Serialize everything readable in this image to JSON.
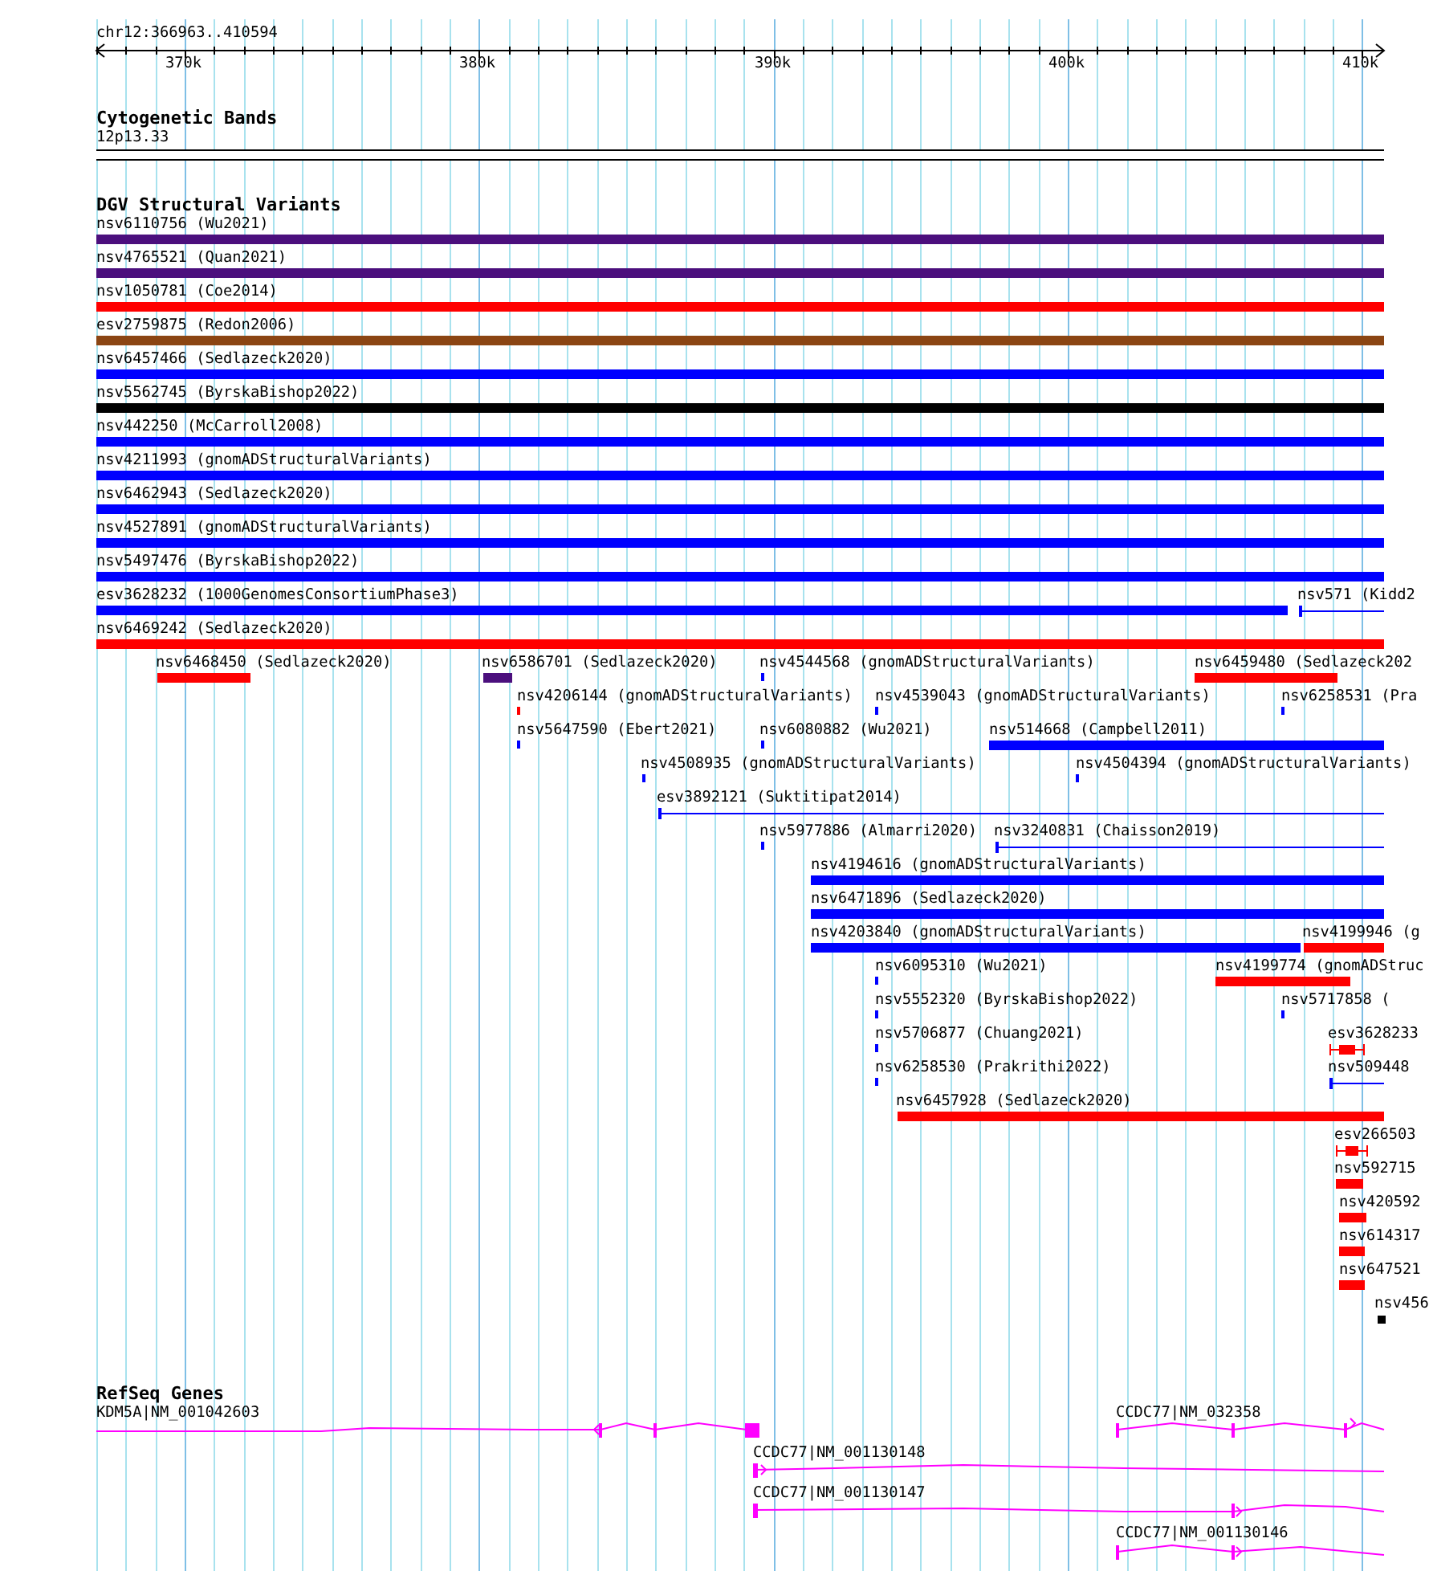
{
  "ruler": {
    "position": "chr12:366963..410594",
    "ticks": [
      "370k",
      "380k",
      "390k",
      "400k",
      "410k"
    ]
  },
  "cytogenetic_bands": {
    "title": "Cytogenetic Bands",
    "band": "12p13.33"
  },
  "dgv": {
    "title": "DGV Structural Variants",
    "rows": [
      {
        "features": [
          {
            "label": "nsv6110756 (Wu2021)",
            "kind": "bar",
            "color": "#4b0f7d"
          }
        ]
      },
      {
        "features": [
          {
            "label": "nsv4765521 (Quan2021)",
            "kind": "bar",
            "color": "#4b0f7d"
          }
        ]
      },
      {
        "features": [
          {
            "label": "nsv1050781 (Coe2014)",
            "kind": "bar",
            "color": "#ff0000"
          }
        ]
      },
      {
        "features": [
          {
            "label": "esv2759875 (Redon2006)",
            "kind": "bar",
            "color": "#8b4513"
          }
        ]
      },
      {
        "features": [
          {
            "label": "nsv6457466 (Sedlazeck2020)",
            "kind": "bar",
            "color": "#0000ff"
          }
        ]
      },
      {
        "features": [
          {
            "label": "nsv5562745 (ByrskaBishop2022)",
            "kind": "bar",
            "color": "#000000"
          }
        ]
      },
      {
        "features": [
          {
            "label": "nsv442250 (McCarroll2008)",
            "kind": "bar",
            "color": "#0000ff"
          }
        ]
      },
      {
        "features": [
          {
            "label": "nsv4211993 (gnomADStructuralVariants)",
            "kind": "bar",
            "color": "#0000ff"
          }
        ]
      },
      {
        "features": [
          {
            "label": "nsv6462943 (Sedlazeck2020)",
            "kind": "bar",
            "color": "#0000ff"
          }
        ]
      },
      {
        "features": [
          {
            "label": "nsv4527891 (gnomADStructuralVariants)",
            "kind": "bar",
            "color": "#0000ff"
          }
        ]
      },
      {
        "features": [
          {
            "label": "nsv5497476 (ByrskaBishop2022)",
            "kind": "bar",
            "color": "#0000ff"
          }
        ]
      },
      {
        "features": [
          {
            "label": "esv3628232 (1000GenomesConsortiumPhase3)",
            "kind": "bar",
            "color": "#0000ff"
          },
          {
            "label": "nsv571 (Kidd2",
            "kind": "span",
            "color": "#0000ff"
          }
        ]
      },
      {
        "features": [
          {
            "label": "nsv6469242 (Sedlazeck2020)",
            "kind": "bar",
            "color": "#ff0000"
          }
        ]
      },
      {
        "features": [
          {
            "label": "nsv6468450 (Sedlazeck2020)",
            "kind": "bar",
            "color": "#ff0000"
          },
          {
            "label": "nsv6586701 (Sedlazeck2020)",
            "kind": "bar",
            "color": "#4b0f7d"
          },
          {
            "label": "nsv4544568 (gnomADStructuralVariants)",
            "kind": "tick",
            "color": "#0000ff"
          },
          {
            "label": "nsv6459480 (Sedlazeck202",
            "kind": "bar",
            "color": "#ff0000"
          }
        ]
      },
      {
        "features": [
          {
            "label": "nsv4206144 (gnomADStructuralVariants)",
            "kind": "tick",
            "color": "#ff0000"
          },
          {
            "label": "nsv4539043 (gnomADStructuralVariants)",
            "kind": "tick",
            "color": "#0000ff"
          },
          {
            "label": "nsv6258531 (Pra",
            "kind": "tick",
            "color": "#0000ff"
          }
        ]
      },
      {
        "features": [
          {
            "label": "nsv5647590 (Ebert2021)",
            "kind": "tick",
            "color": "#0000ff"
          },
          {
            "label": "nsv6080882 (Wu2021)",
            "kind": "tick",
            "color": "#0000ff"
          },
          {
            "label": "nsv514668 (Campbell2011)",
            "kind": "bar",
            "color": "#0000ff"
          }
        ]
      },
      {
        "features": [
          {
            "label": "nsv4508935 (gnomADStructuralVariants)",
            "kind": "tick",
            "color": "#0000ff"
          },
          {
            "label": "nsv4504394 (gnomADStructuralVariants)",
            "kind": "tick",
            "color": "#0000ff"
          }
        ]
      },
      {
        "features": [
          {
            "label": "esv3892121 (Suktitipat2014)",
            "kind": "span",
            "color": "#0000ff"
          }
        ]
      },
      {
        "features": [
          {
            "label": "nsv5977886 (Almarri2020)",
            "kind": "tick",
            "color": "#0000ff"
          },
          {
            "label": "nsv3240831 (Chaisson2019)",
            "kind": "span",
            "color": "#0000ff"
          }
        ]
      },
      {
        "features": [
          {
            "label": "nsv4194616 (gnomADStructuralVariants)",
            "kind": "bar",
            "color": "#0000ff"
          }
        ]
      },
      {
        "features": [
          {
            "label": "nsv6471896 (Sedlazeck2020)",
            "kind": "bar",
            "color": "#0000ff"
          }
        ]
      },
      {
        "features": [
          {
            "label": "nsv4203840 (gnomADStructuralVariants)",
            "kind": "bar",
            "color": "#0000ff"
          },
          {
            "label": "nsv4199946 (g",
            "kind": "bar",
            "color": "#ff0000"
          }
        ]
      },
      {
        "features": [
          {
            "label": "nsv6095310 (Wu2021)",
            "kind": "tick",
            "color": "#0000ff"
          },
          {
            "label": "nsv4199774 (gnomADStruc",
            "kind": "bar",
            "color": "#ff0000"
          }
        ]
      },
      {
        "features": [
          {
            "label": "nsv5552320 (ByrskaBishop2022)",
            "kind": "tick",
            "color": "#0000ff"
          },
          {
            "label": "nsv5717858 (",
            "kind": "tick",
            "color": "#0000ff"
          }
        ]
      },
      {
        "features": [
          {
            "label": "nsv5706877 (Chuang2021)",
            "kind": "tick",
            "color": "#0000ff"
          },
          {
            "label": "esv3628233",
            "kind": "whisker",
            "color": "#ff0000"
          }
        ]
      },
      {
        "features": [
          {
            "label": "nsv6258530 (Prakrithi2022)",
            "kind": "tick",
            "color": "#0000ff"
          },
          {
            "label": "nsv509448",
            "kind": "span",
            "color": "#0000ff"
          }
        ]
      },
      {
        "features": [
          {
            "label": "nsv6457928 (Sedlazeck2020)",
            "kind": "bar",
            "color": "#ff0000"
          }
        ]
      },
      {
        "features": [
          {
            "label": "esv266503",
            "kind": "whisker",
            "color": "#ff0000"
          }
        ]
      },
      {
        "features": [
          {
            "label": "nsv592715",
            "kind": "bar",
            "color": "#ff0000"
          }
        ]
      },
      {
        "features": [
          {
            "label": "nsv420592",
            "kind": "bar",
            "color": "#ff0000"
          }
        ]
      },
      {
        "features": [
          {
            "label": "nsv614317",
            "kind": "bar",
            "color": "#ff0000"
          }
        ]
      },
      {
        "features": [
          {
            "label": "nsv647521",
            "kind": "bar",
            "color": "#ff0000"
          }
        ]
      },
      {
        "features": [
          {
            "label": "nsv456",
            "kind": "square",
            "color": "#000000"
          }
        ]
      }
    ]
  },
  "refseq": {
    "title": "RefSeq Genes",
    "genes": [
      {
        "label": "KDM5A|NM_001042603"
      },
      {
        "label": "CCDC77|NM_032358"
      },
      {
        "label": "CCDC77|NM_001130148"
      },
      {
        "label": "CCDC77|NM_001130147"
      },
      {
        "label": "CCDC77|NM_001130146"
      }
    ]
  }
}
